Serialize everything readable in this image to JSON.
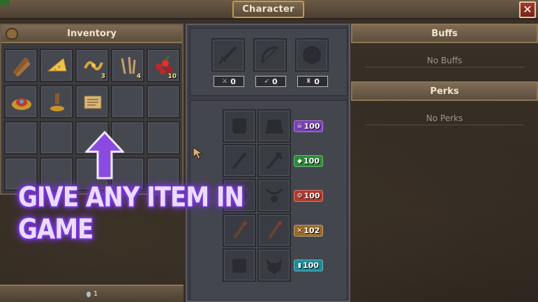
{
  "window": {
    "title": "Character",
    "close_label": "✕"
  },
  "inventory": {
    "title": "Inventory",
    "currency_value": "1",
    "slots": [
      {
        "item": "wood-planks-icon",
        "qty": ""
      },
      {
        "item": "cheese-icon",
        "qty": ""
      },
      {
        "item": "golden-vine-icon",
        "qty": "3"
      },
      {
        "item": "nails-icon",
        "qty": "4"
      },
      {
        "item": "berries-icon",
        "qty": "10"
      },
      {
        "item": "meat-dish-icon",
        "qty": ""
      },
      {
        "item": "seal-stamp-icon",
        "qty": ""
      },
      {
        "item": "scroll-paper-icon",
        "qty": ""
      },
      {
        "item": "",
        "qty": ""
      },
      {
        "item": "",
        "qty": ""
      },
      {
        "item": "",
        "qty": ""
      },
      {
        "item": "",
        "qty": ""
      },
      {
        "item": "",
        "qty": ""
      },
      {
        "item": "",
        "qty": ""
      },
      {
        "item": "",
        "qty": ""
      },
      {
        "item": "",
        "qty": ""
      },
      {
        "item": "",
        "qty": ""
      },
      {
        "item": "",
        "qty": ""
      },
      {
        "item": "",
        "qty": ""
      },
      {
        "item": "",
        "qty": ""
      }
    ]
  },
  "character": {
    "equipment_top": [
      {
        "slot": "sword-icon"
      },
      {
        "slot": "bow-icon"
      },
      {
        "slot": "armor-icon"
      }
    ],
    "stats": [
      {
        "icon": "melee-stat-icon",
        "value": "0"
      },
      {
        "icon": "ranged-stat-icon",
        "value": "0"
      },
      {
        "icon": "defense-stat-icon",
        "value": "0"
      }
    ],
    "resources": [
      {
        "icon": "skull-icon",
        "value": "100",
        "color": "#7a3fb8"
      },
      {
        "icon": "food-icon",
        "value": "100",
        "color": "#2d8a3a"
      },
      {
        "icon": "gear-icon",
        "value": "100",
        "color": "#b33a2a"
      },
      {
        "icon": "tool-icon",
        "value": "102",
        "color": "#9a6a2a"
      },
      {
        "icon": "book-icon",
        "value": "100",
        "color": "#1f8a9a"
      }
    ]
  },
  "buffs": {
    "title": "Buffs",
    "empty_text": "No Buffs"
  },
  "perks": {
    "title": "Perks",
    "empty_text": "No Perks"
  },
  "overlay": {
    "promo_text": "GIVE ANY ITEM IN GAME",
    "accent_color": "#7d3fd6"
  }
}
